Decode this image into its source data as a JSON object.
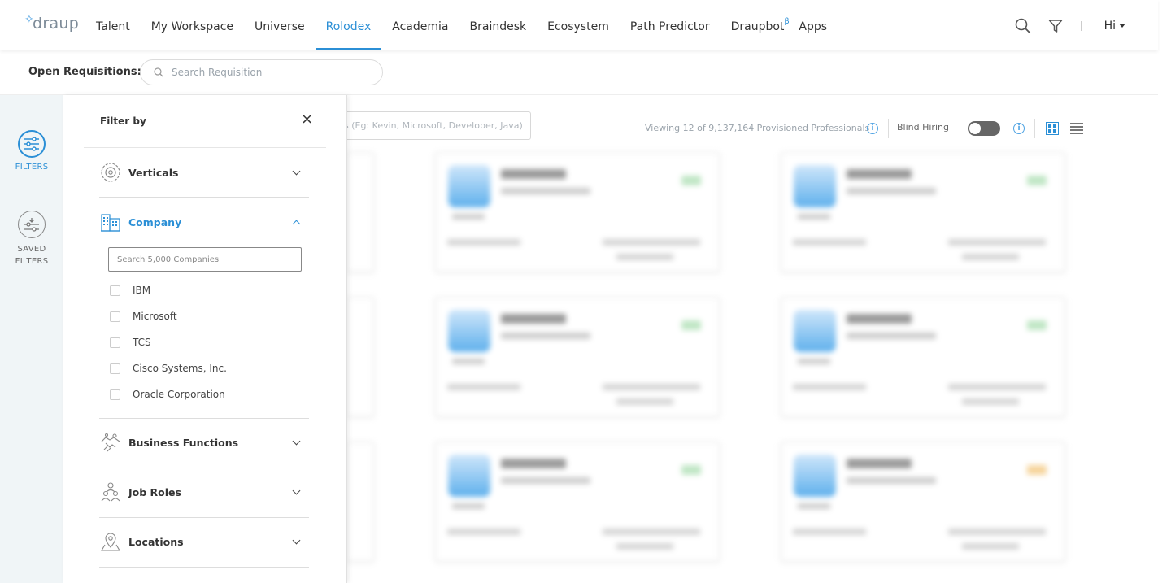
{
  "brand": {
    "name": "draup"
  },
  "nav": {
    "items": [
      {
        "label": "Talent",
        "active": false
      },
      {
        "label": "My Workspace",
        "active": false
      },
      {
        "label": "Universe",
        "active": false
      },
      {
        "label": "Rolodex",
        "active": true
      },
      {
        "label": "Academia",
        "active": false
      },
      {
        "label": "Braindesk",
        "active": false
      },
      {
        "label": "Ecosystem",
        "active": false
      },
      {
        "label": "Path Predictor",
        "active": false
      },
      {
        "label": "Draupbot",
        "superscript": "β",
        "active": false
      },
      {
        "label": "Apps",
        "active": false
      }
    ],
    "greeting": "Hi"
  },
  "requisitions": {
    "label": "Open Requisitions:",
    "search_placeholder": "Search Requisition"
  },
  "rail": {
    "filters_label": "FILTERS",
    "saved_label_1": "SAVED",
    "saved_label_2": "FILTERS"
  },
  "toolbar": {
    "keyword_placeholder": "s (Eg: Kevin, Microsoft, Developer, Java)",
    "viewing_text": "Viewing 12 of 9,137,164 Provisioned Professionals",
    "blind_hiring_label": "Blind Hiring",
    "blind_hiring_on": false,
    "view_mode": "grid"
  },
  "filter_panel": {
    "title": "Filter by",
    "close_symbol": "×",
    "sections": {
      "verticals": "Verticals",
      "company": "Company",
      "business_functions": "Business Functions",
      "job_roles": "Job Roles",
      "locations": "Locations"
    },
    "company_search_placeholder": "Search 5,000 Companies",
    "companies": [
      "IBM",
      "Microsoft",
      "TCS",
      "Cisco Systems, Inc.",
      "Oracle Corporation"
    ]
  },
  "colors": {
    "accent": "#2b8fd6",
    "text": "#333333",
    "rail_bg": "#f0f5f7"
  }
}
